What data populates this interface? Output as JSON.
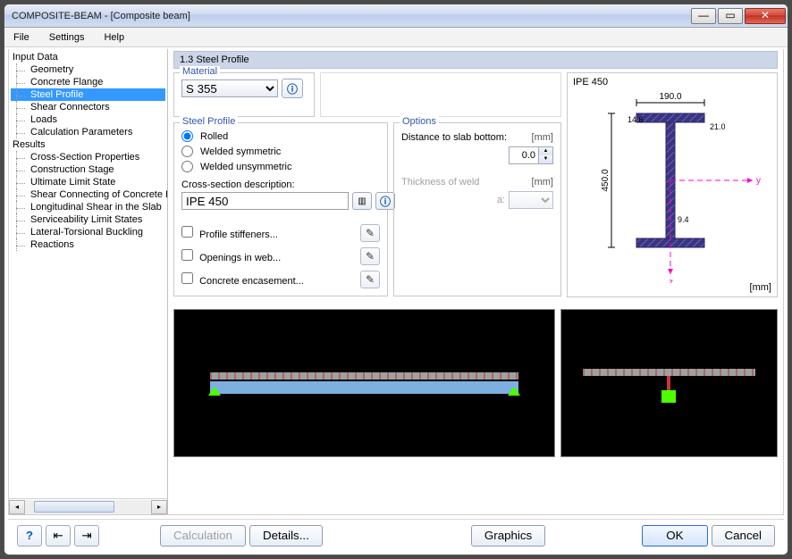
{
  "window": {
    "title": "COMPOSITE-BEAM - [Composite beam]"
  },
  "menu": {
    "file": "File",
    "settings": "Settings",
    "help": "Help"
  },
  "tree": {
    "input": "Input Data",
    "input_items": [
      "Geometry",
      "Concrete Flange",
      "Steel Profile",
      "Shear Connectors",
      "Loads",
      "Calculation Parameters"
    ],
    "results": "Results",
    "results_items": [
      "Cross-Section Properties",
      "Construction Stage",
      "Ultimate Limit State",
      "Shear Connecting of Concrete Flange",
      "Longitudinal Shear in the Slab",
      "Serviceability Limit States",
      "Lateral-Torsional Buckling",
      "Reactions"
    ],
    "selected_index": 2
  },
  "page": {
    "title": "1.3 Steel Profile"
  },
  "material": {
    "legend": "Material",
    "value": "S 355",
    "options": [
      "S 355"
    ]
  },
  "steel_profile": {
    "legend": "Steel Profile",
    "rolled": "Rolled",
    "welded_sym": "Welded symmetric",
    "welded_unsym": "Welded unsymmetric",
    "profile_type": "rolled",
    "cs_label": "Cross-section description:",
    "cs_value": "IPE 450",
    "stiffeners": "Profile stiffeners...",
    "openings": "Openings in web...",
    "encasement": "Concrete encasement...",
    "stiffeners_checked": false,
    "openings_checked": false,
    "encasement_checked": false
  },
  "options": {
    "legend": "Options",
    "distance_label": "Distance to slab bottom:",
    "distance_value": "0.0",
    "unit": "[mm]",
    "thickness_label": "Thickness of weld",
    "thickness_a": "a:"
  },
  "graphic": {
    "caption": "IPE 450",
    "unit": "[mm]",
    "dims": {
      "width": "190.0",
      "height": "450.0",
      "tf": "14.6",
      "tw": "9.4",
      "r": "21.0"
    },
    "axes": {
      "y": "y",
      "z": "z"
    }
  },
  "footer": {
    "calculation": "Calculation",
    "details": "Details...",
    "graphics": "Graphics",
    "ok": "OK",
    "cancel": "Cancel"
  }
}
